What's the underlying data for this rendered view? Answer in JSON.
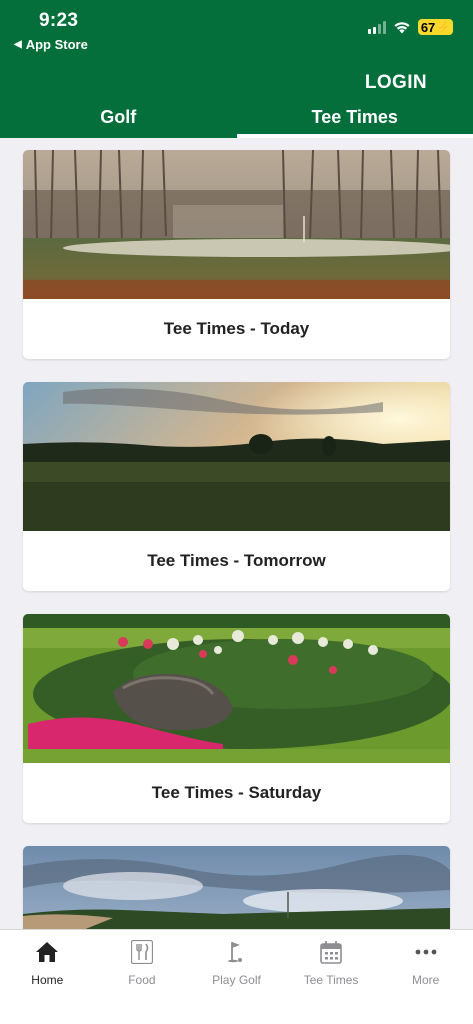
{
  "status_bar": {
    "time": "9:23",
    "back_label": "App Store",
    "battery": "67"
  },
  "header": {
    "login_label": "LOGIN",
    "tabs": [
      {
        "label": "Golf",
        "active": false
      },
      {
        "label": "Tee Times",
        "active": true
      }
    ]
  },
  "cards": [
    {
      "label": "Tee Times - Today"
    },
    {
      "label": "Tee Times - Tomorrow"
    },
    {
      "label": "Tee Times - Saturday"
    },
    {
      "label": ""
    }
  ],
  "bottom_nav": [
    {
      "label": "Home",
      "icon": "home-icon",
      "active": true
    },
    {
      "label": "Food",
      "icon": "fork-knife-icon",
      "active": false
    },
    {
      "label": "Play Golf",
      "icon": "golf-flag-icon",
      "active": false
    },
    {
      "label": "Tee Times",
      "icon": "calendar-icon",
      "active": false
    },
    {
      "label": "More",
      "icon": "more-dots-icon",
      "active": false
    }
  ],
  "colors": {
    "header_green": "#046f3b",
    "battery_yellow": "#f7d92e",
    "background": "#efeff4"
  }
}
